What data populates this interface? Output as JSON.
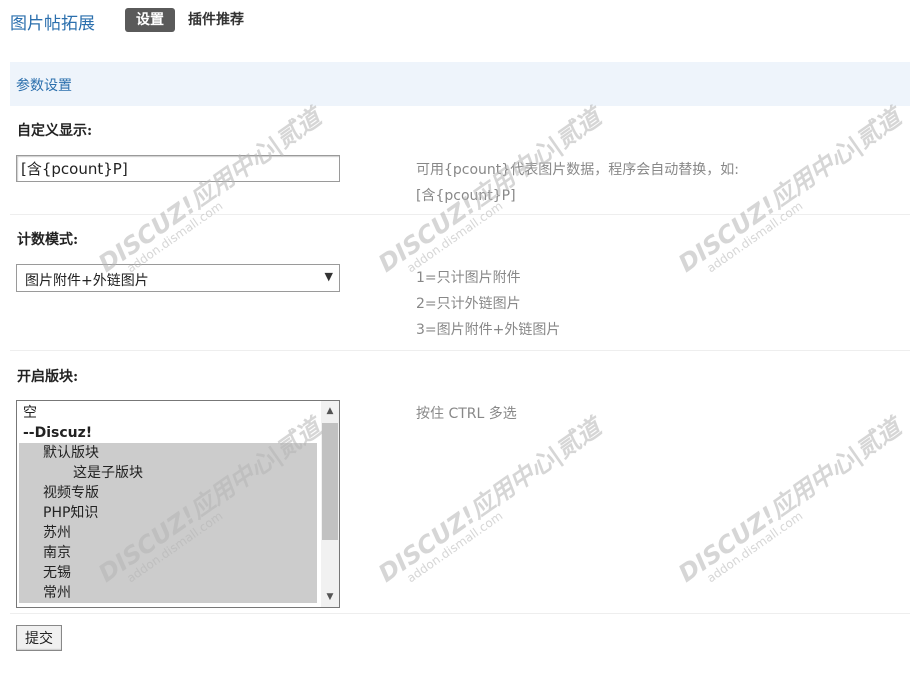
{
  "header": {
    "plugin_title": "图片帖拓展",
    "tabs": [
      {
        "label": "设置",
        "active": true
      },
      {
        "label": "插件推荐",
        "active": false
      }
    ]
  },
  "section": {
    "title": "参数设置"
  },
  "fields": {
    "custom_display": {
      "label": "自定义显示:",
      "value": "[含{pcount}P]",
      "tip_line1": "可用{pcount}代表图片数据，程序会自动替换，如:",
      "tip_line2": "[含{pcount}P]"
    },
    "count_mode": {
      "label": "计数模式:",
      "selected": "图片附件+外链图片",
      "tips": [
        "1=只计图片附件",
        "2=只计外链图片",
        "3=图片附件+外链图片"
      ]
    },
    "forums": {
      "label": "开启版块:",
      "tip": "按住 CTRL 多选",
      "options": [
        {
          "label": "空",
          "selected": false
        },
        {
          "label": "--Discuz!",
          "selected": false
        },
        {
          "label": "默认版块",
          "selected": true
        },
        {
          "label": "这是子版块",
          "selected": true
        },
        {
          "label": "视频专版",
          "selected": true
        },
        {
          "label": "PHP知识",
          "selected": true
        },
        {
          "label": "苏州",
          "selected": true
        },
        {
          "label": "南京",
          "selected": true
        },
        {
          "label": "无锡",
          "selected": true
        },
        {
          "label": "常州",
          "selected": true
        }
      ]
    }
  },
  "submit_label": "提交",
  "watermark": {
    "line1": "DISCUZ!应用中心|贰道",
    "line2": "addon.dismall.com"
  }
}
